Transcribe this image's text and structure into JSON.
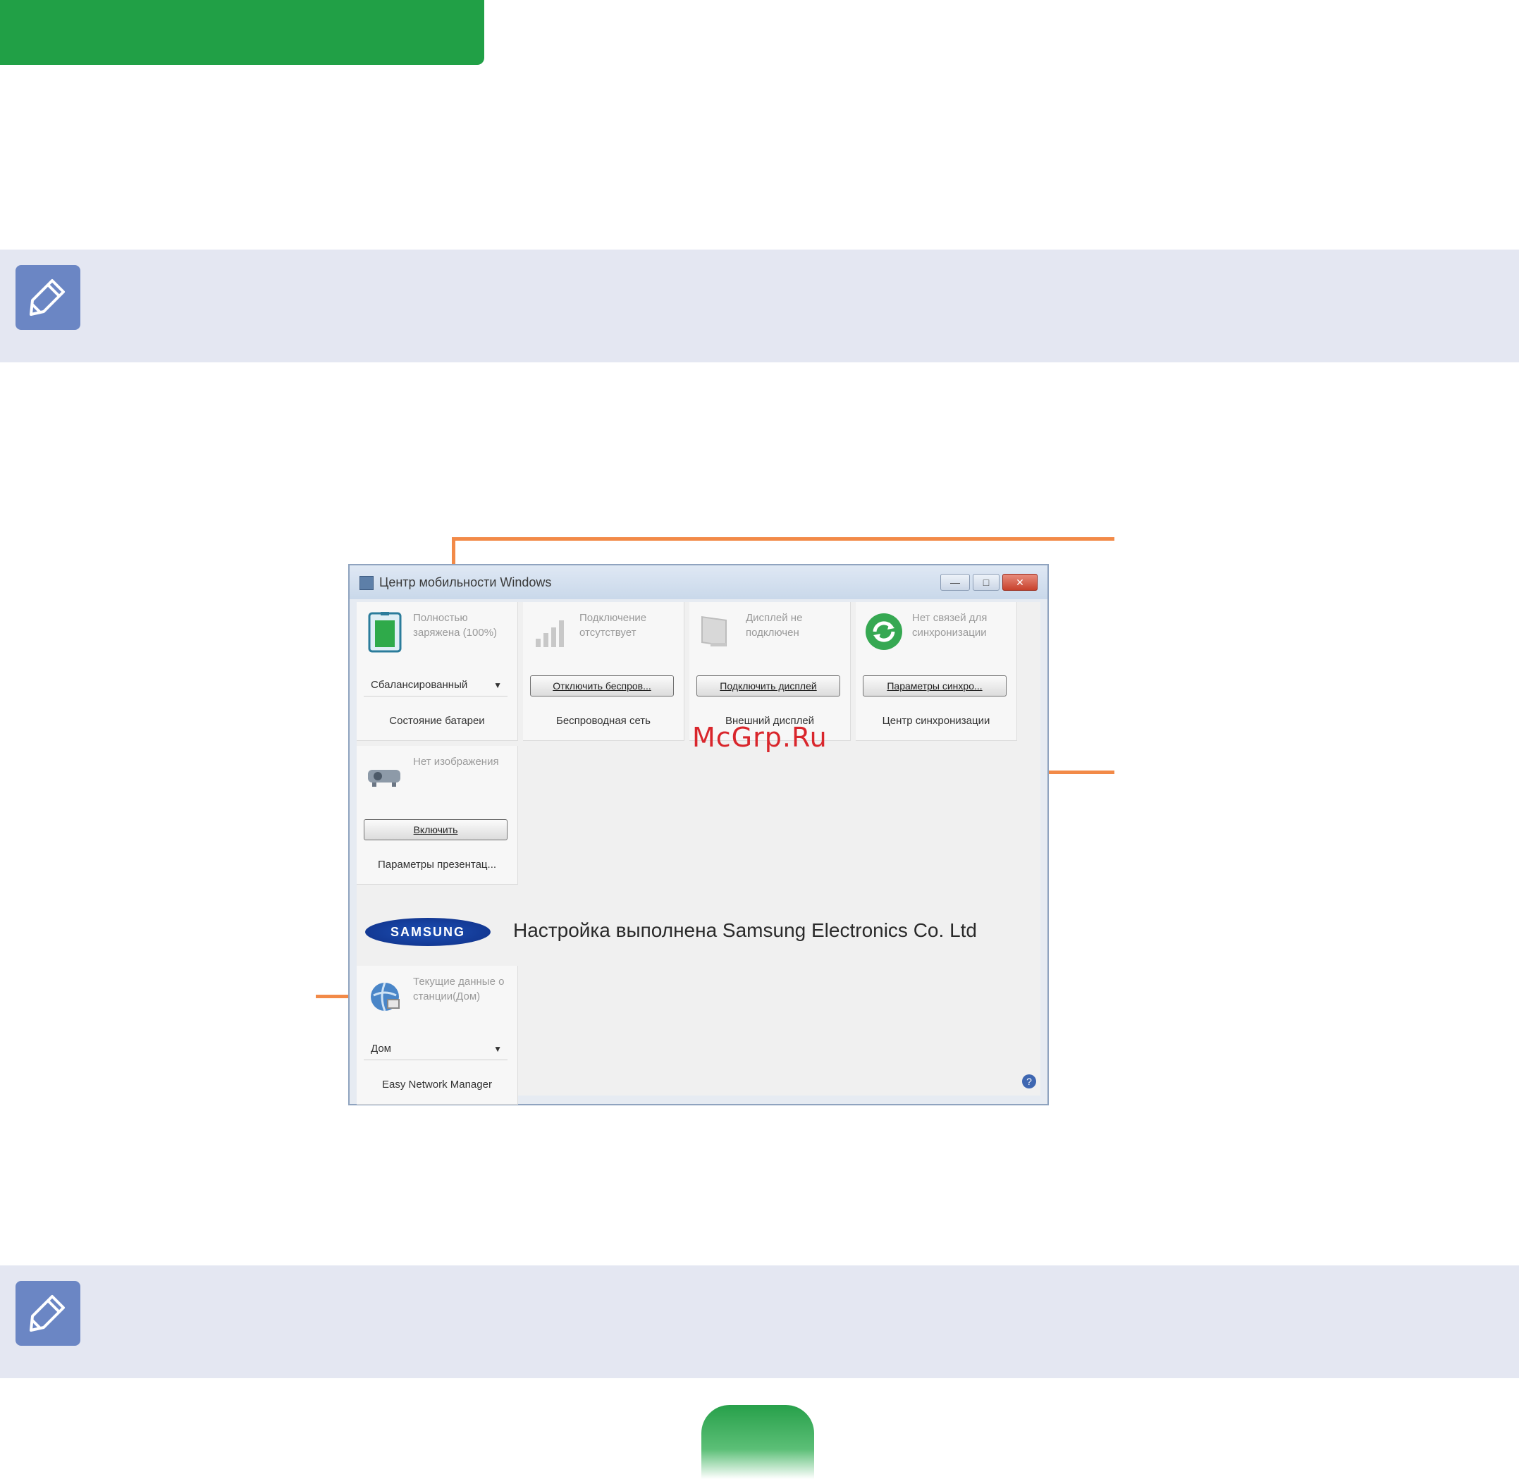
{
  "note": {
    "icon": "pencil-note-icon"
  },
  "window": {
    "title": "Центр мобильности Windows",
    "controls": {
      "minimize": "—",
      "maximize": "□",
      "close": "✕"
    }
  },
  "tiles": {
    "battery": {
      "status": "Полностью заряжена (100%)",
      "select_value": "Сбалансированный",
      "name": "Состояние батареи"
    },
    "wireless": {
      "status": "Подключение отсутствует",
      "button": "Отключить беспров...",
      "name": "Беспроводная сеть"
    },
    "display": {
      "status": "Дисплей не подключен",
      "button": "Подключить дисплей",
      "name": "Внешний дисплей"
    },
    "sync": {
      "status": "Нет связей для синхронизации",
      "button": "Параметры синхро...",
      "name": "Центр синхронизации"
    },
    "presentation": {
      "status": "Нет изображения",
      "button": "Включить",
      "name": "Параметры презентац..."
    },
    "network": {
      "status": "Текущие данные о станции(Дом)",
      "select_value": "Дом",
      "name": "Easy Network Manager"
    }
  },
  "brand": {
    "logo_text": "SAMSUNG",
    "text": "Настройка выполнена Samsung Electronics Co. Ltd"
  },
  "watermark": "McGrp.Ru",
  "colors": {
    "header_green": "#21a046",
    "note_band": "#e4e7f2",
    "callout": "#f28a48"
  }
}
